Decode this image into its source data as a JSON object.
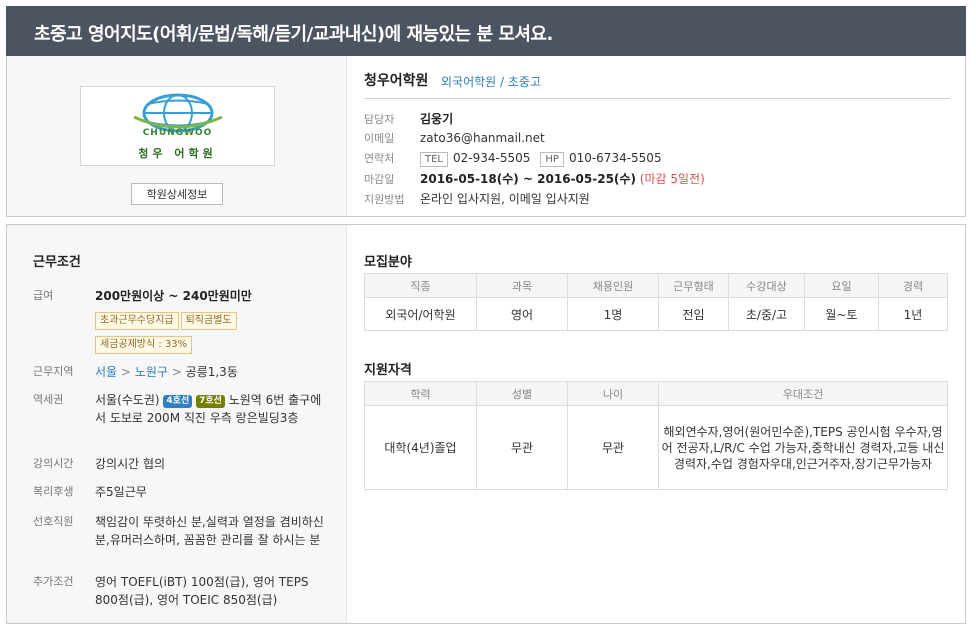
{
  "posting_title": "초중고 영어지도(어휘/문법/독해/듣기/교과내신)에 재능있는 분 모셔요.",
  "academy": {
    "logo_text_en": "CHUNGWOO",
    "logo_text_kr": "청우 어학원",
    "detail_button": "학원상세정보",
    "name": "청우어학원",
    "category": "외국어학원 / 초중고",
    "info": {
      "manager_label": "담당자",
      "manager": "김웅기",
      "email_label": "이메일",
      "email": "zato36@hanmail.net",
      "contact_label": "연락처",
      "tel_tag": "TEL",
      "tel": "02-934-5505",
      "hp_tag": "HP",
      "hp": "010-6734-5505",
      "deadline_label": "마감일",
      "deadline": "2016-05-18(수) ~ 2016-05-25(수)",
      "deadline_note": "(마감 5일전)",
      "apply_label": "지원방법",
      "apply_method": "온라인 입사지원, 이메일 입사지원"
    }
  },
  "conditions": {
    "heading": "근무조건",
    "salary_label": "급여",
    "salary": "200만원이상 ~ 240만원미만",
    "salary_tags": [
      "초과근무수당지급",
      "퇴직금별도",
      "세금공제방식 : 33%"
    ],
    "location_label": "근무지역",
    "location_city": "서울",
    "location_district": "노원구",
    "location_dong": "공릉1,3동",
    "location_sep": ">",
    "station_label": "역세권",
    "station_prefix": "서울(수도권)",
    "line4": "4호선",
    "line7": "7호선",
    "station_text": "노원역 6번 출구에서 도보로 200M 직진 우측 랑은빌딩3층",
    "hours_label": "강의시간",
    "hours": "강의시간 협의",
    "welfare_label": "복리후생",
    "welfare": "주5일근무",
    "preferred_label": "선호직원",
    "preferred": "책임감이 뚜렷하신 분,실력과 열정을 겸비하신 분,유머러스하며, 꼼꼼한 관리를 잘 하시는 분",
    "extra_label": "추가조건",
    "extra": "영어 TOEFL(iBT) 100점(급), 영어 TEPS 800점(급), 영어 TOEIC 850점(급)"
  },
  "recruit": {
    "heading": "모집분야",
    "headers": [
      "직종",
      "과목",
      "채용인원",
      "근무형태",
      "수강대상",
      "요일",
      "경력"
    ],
    "row": [
      "외국어/어학원",
      "영어",
      "1명",
      "전임",
      "초/중/고",
      "월~토",
      "1년"
    ]
  },
  "qualification": {
    "heading": "지원자격",
    "headers": [
      "학력",
      "성별",
      "나이",
      "우대조건"
    ],
    "education": "대학(4년)졸업",
    "gender": "무관",
    "age": "무관",
    "preference": "해외연수자,영어(원어민수준),TEPS 공인시험 우수자,영어 전공자,L/R/C 수업 가능자,중학내신 경력자,고등 내신 경력자,수업 경험자우대,인근거주자,장기근무가능자"
  },
  "colors": {
    "title_bar": "#4b5460",
    "link": "#2f7db8",
    "deadline_note": "#d9534f",
    "line4": "#2f7fc1",
    "line7": "#747f00",
    "tag_border": "#e3c58c"
  }
}
